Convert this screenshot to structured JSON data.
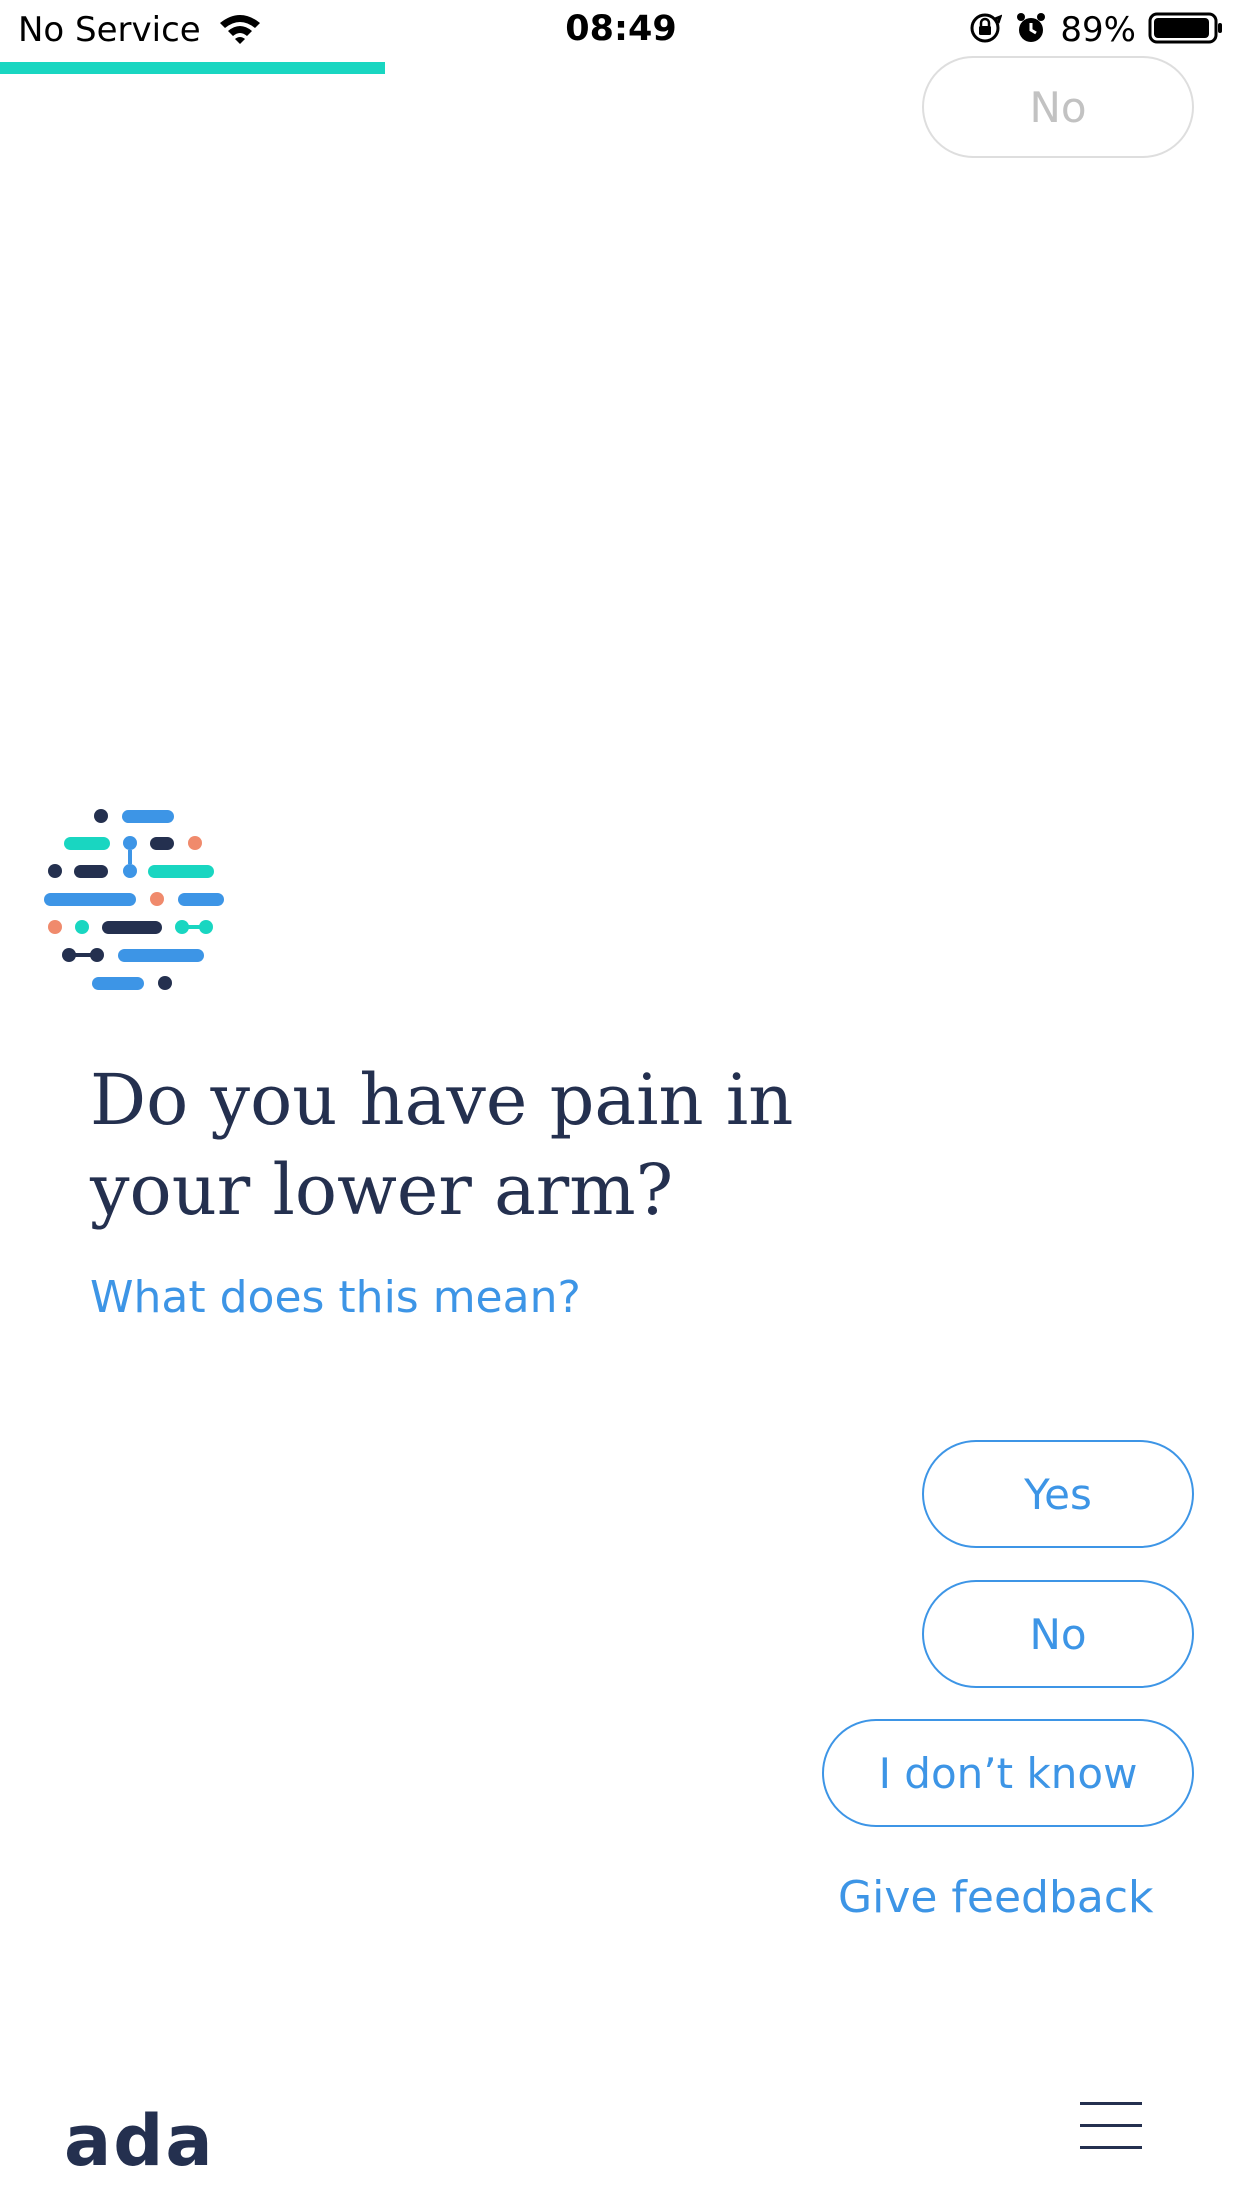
{
  "status_bar": {
    "carrier": "No Service",
    "time": "08:49",
    "battery": "89%",
    "icons": [
      "wifi-icon",
      "orientation-lock-icon",
      "alarm-icon",
      "battery-icon"
    ]
  },
  "progress": {
    "fraction": 0.31,
    "color": "#19d6c1"
  },
  "previous_answer": {
    "label": "No"
  },
  "question": {
    "line1": "Do you have pain in",
    "line2": "your lower arm?",
    "help_link": "What does this mean?"
  },
  "answers": {
    "yes": "Yes",
    "no": "No",
    "dont_know": "I don’t know"
  },
  "feedback_link": "Give feedback",
  "footer": {
    "brand": "ada",
    "menu_icon": "hamburger-menu-icon"
  },
  "colors": {
    "accent": "#3d95e6",
    "text": "#24304f",
    "teal": "#19d6c1",
    "coral": "#f08a6c"
  }
}
